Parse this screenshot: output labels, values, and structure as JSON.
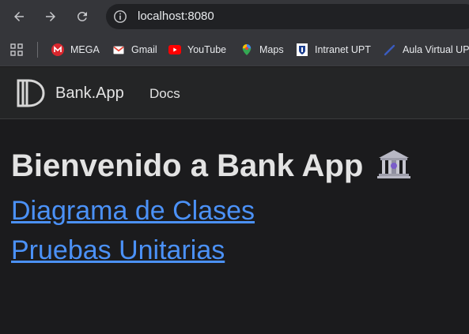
{
  "browser": {
    "url": "localhost:8080",
    "bookmarks": [
      {
        "label": "MEGA",
        "icon": "mega-icon"
      },
      {
        "label": "Gmail",
        "icon": "gmail-icon"
      },
      {
        "label": "YouTube",
        "icon": "youtube-icon"
      },
      {
        "label": "Maps",
        "icon": "maps-icon"
      },
      {
        "label": "Intranet UPT",
        "icon": "intranet-upt-icon"
      },
      {
        "label": "Aula Virtual UPT",
        "icon": "aula-virtual-icon"
      }
    ]
  },
  "navbar": {
    "brand": "Bank.App",
    "links": [
      "Docs"
    ]
  },
  "main": {
    "heading_prefix": "Bienvenido a",
    "heading_strong": "Bank App",
    "links": [
      "Diagrama de Clases",
      "Pruebas Unitarias"
    ]
  },
  "colors": {
    "background": "#1b1b1d",
    "navbar": "#242526",
    "link": "#4b91f7",
    "text": "#e3e3e3"
  }
}
